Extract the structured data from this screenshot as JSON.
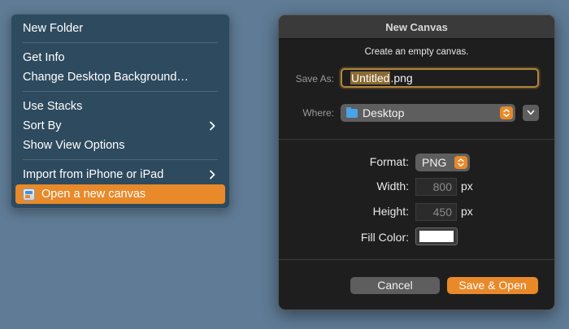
{
  "context_menu": {
    "items": {
      "new_folder": "New Folder",
      "get_info": "Get Info",
      "change_background": "Change Desktop Background…",
      "use_stacks": "Use Stacks",
      "sort_by": "Sort By",
      "show_view_options": "Show View Options",
      "import_from_iphone": "Import from iPhone or iPad",
      "open_new_canvas": "Open a new canvas"
    },
    "highlight_color": "#e8892a"
  },
  "dialog": {
    "title": "New Canvas",
    "subtitle": "Create an empty canvas.",
    "save_as": {
      "label": "Save As:",
      "value_selected": "Untitled",
      "value_suffix": ".png"
    },
    "where": {
      "label": "Where:",
      "value": "Desktop"
    },
    "format": {
      "label": "Format:",
      "value": "PNG"
    },
    "width": {
      "label": "Width:",
      "value": "800",
      "unit": "px"
    },
    "height": {
      "label": "Height:",
      "value": "450",
      "unit": "px"
    },
    "fill_color": {
      "label": "Fill Color:",
      "value": "#ffffff"
    },
    "buttons": {
      "cancel": "Cancel",
      "primary": "Save & Open"
    },
    "accent_color": "#e8892a"
  }
}
